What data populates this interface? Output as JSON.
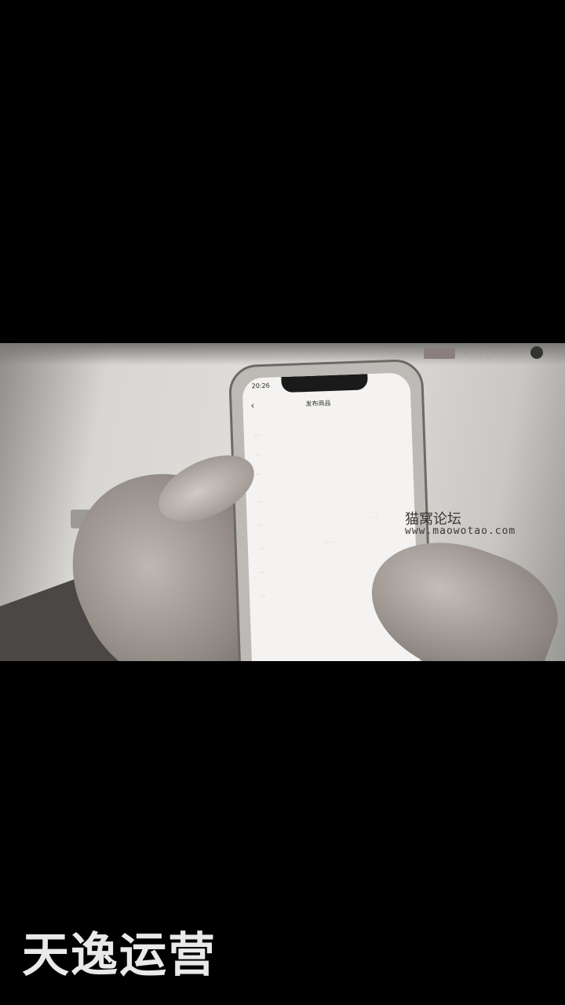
{
  "photo": {
    "site_header_text": "",
    "site_logo": "",
    "left_button": "",
    "watermark_name": "猫窝论坛",
    "watermark_url": "www.maowotao.com"
  },
  "phone": {
    "time": "20:26",
    "nav_title": "发布商品",
    "back_icon": "chevron-left-icon"
  },
  "brand_caption": "天逸运营"
}
